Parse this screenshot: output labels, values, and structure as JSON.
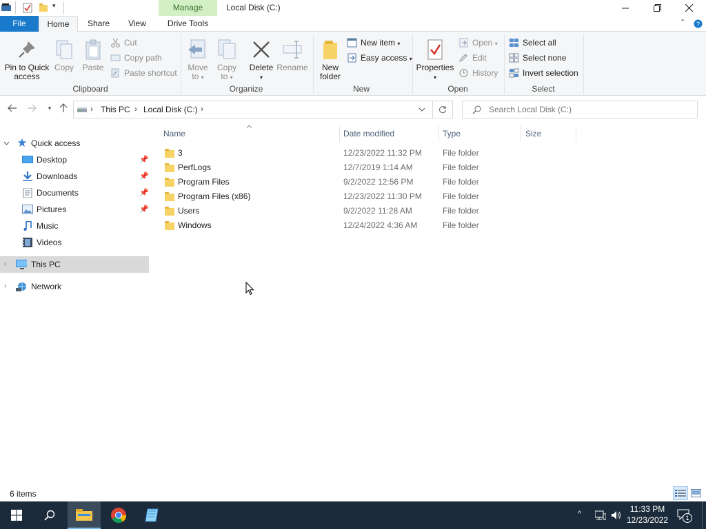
{
  "window": {
    "title": "Local Disk (C:)",
    "context_tab_group": "Manage"
  },
  "tabs": {
    "file": "File",
    "home": "Home",
    "share": "Share",
    "view": "View",
    "drive_tools": "Drive Tools"
  },
  "ribbon": {
    "clipboard": {
      "label": "Clipboard",
      "pin": "Pin to Quick access",
      "pin_l1": "Pin to Quick",
      "pin_l2": "access",
      "copy": "Copy",
      "paste": "Paste",
      "cut": "Cut",
      "copy_path": "Copy path",
      "paste_shortcut": "Paste shortcut"
    },
    "organize": {
      "label": "Organize",
      "move_l1": "Move",
      "move_l2": "to",
      "copy_l1": "Copy",
      "copy_l2": "to",
      "delete": "Delete",
      "rename": "Rename"
    },
    "new": {
      "label": "New",
      "new_folder_l1": "New",
      "new_folder_l2": "folder",
      "new_item": "New item",
      "easy_access": "Easy access"
    },
    "open": {
      "label": "Open",
      "properties": "Properties",
      "open": "Open",
      "edit": "Edit",
      "history": "History"
    },
    "select": {
      "label": "Select",
      "select_all": "Select all",
      "select_none": "Select none",
      "invert": "Invert selection"
    }
  },
  "address": {
    "crumbs": [
      "This PC",
      "Local Disk (C:)"
    ],
    "search_placeholder": "Search Local Disk (C:)"
  },
  "nav": {
    "quick_access": "Quick access",
    "items": [
      {
        "label": "Desktop",
        "pinned": true
      },
      {
        "label": "Downloads",
        "pinned": true
      },
      {
        "label": "Documents",
        "pinned": true
      },
      {
        "label": "Pictures",
        "pinned": true
      },
      {
        "label": "Music",
        "pinned": false
      },
      {
        "label": "Videos",
        "pinned": false
      }
    ],
    "this_pc": "This PC",
    "network": "Network"
  },
  "columns": {
    "name": "Name",
    "date": "Date modified",
    "type": "Type",
    "size": "Size"
  },
  "files": [
    {
      "name": "3",
      "date": "12/23/2022 11:32 PM",
      "type": "File folder"
    },
    {
      "name": "PerfLogs",
      "date": "12/7/2019 1:14 AM",
      "type": "File folder"
    },
    {
      "name": "Program Files",
      "date": "9/2/2022 12:56 PM",
      "type": "File folder"
    },
    {
      "name": "Program Files (x86)",
      "date": "12/23/2022 11:30 PM",
      "type": "File folder"
    },
    {
      "name": "Users",
      "date": "9/2/2022 11:28 AM",
      "type": "File folder"
    },
    {
      "name": "Windows",
      "date": "12/24/2022 4:36 AM",
      "type": "File folder"
    }
  ],
  "status": {
    "count": "6 items"
  },
  "taskbar": {
    "time": "11:33 PM",
    "date": "12/23/2022",
    "notifications": "1"
  },
  "colors": {
    "accent": "#1979ca",
    "manage": "#d3f0c4",
    "taskbar": "#1c2b3b",
    "folder": "#f7d264"
  }
}
